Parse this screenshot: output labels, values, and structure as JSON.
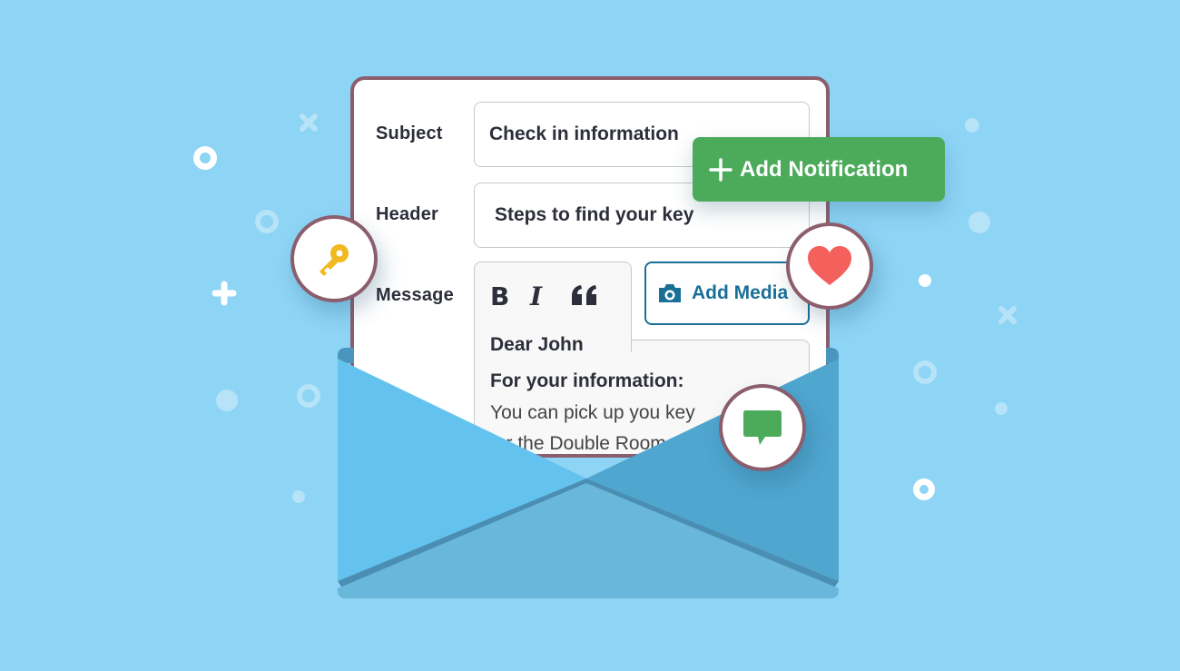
{
  "form": {
    "subject_label": "Subject",
    "subject_value": "Check in information",
    "header_label": "Header",
    "header_value": "Steps to find your key",
    "message_label": "Message",
    "toolbar": {
      "bold_label": "B",
      "italic_label": "I",
      "quote_label": "66"
    },
    "add_media_label": "Add Media",
    "message_lines": [
      "Dear John",
      "For your information:",
      "You can pick up you key",
      "for the Double Room"
    ]
  },
  "notification_button": {
    "icon": "plus-icon",
    "label": "Add Notification"
  },
  "badges": [
    {
      "icon": "key-icon",
      "color": "#f2b81f"
    },
    {
      "icon": "heart-icon",
      "color": "#f4605c"
    },
    {
      "icon": "chat-bubble-icon",
      "color": "#4caa5b"
    }
  ],
  "colors": {
    "background": "#8dd4f5",
    "card_border": "#8b5e6e",
    "accent_green": "#4caa5b",
    "media_blue": "#1a6f96",
    "envelope_light": "#64c3ee",
    "envelope_mid": "#6ab7dc",
    "envelope_dark": "#4fa6cf"
  }
}
